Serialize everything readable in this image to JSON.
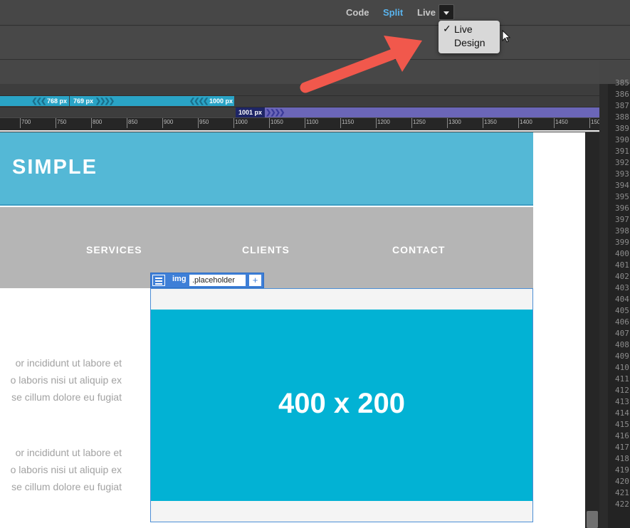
{
  "toolbar": {
    "code": "Code",
    "split": "Split",
    "live": "Live"
  },
  "view_menu": {
    "check": "✓",
    "items": [
      "Live",
      "Design"
    ]
  },
  "media_queries": {
    "mq1": "768",
    "mq2_left": "769",
    "mq2_right": "1000",
    "mq3": "1001",
    "unit": "px"
  },
  "ruler_ticks": [
    "700",
    "750",
    "800",
    "850",
    "900",
    "950",
    "1000",
    "1050",
    "1100",
    "1150",
    "1200",
    "1250",
    "1300",
    "1350",
    "1400",
    "1450",
    "150"
  ],
  "line_numbers": [
    "385",
    "386",
    "387",
    "388",
    "389",
    "390",
    "391",
    "392",
    "393",
    "394",
    "395",
    "396",
    "397",
    "398",
    "399",
    "400",
    "401",
    "402",
    "403",
    "404",
    "405",
    "406",
    "407",
    "408",
    "409",
    "410",
    "411",
    "412",
    "413",
    "414",
    "415",
    "416",
    "417",
    "418",
    "419",
    "420",
    "421",
    "422"
  ],
  "page": {
    "logo": "SIMPLE",
    "nav": [
      "SERVICES",
      "CLIENTS",
      "CONTACT"
    ],
    "para1": [
      "or incididunt ut labore et",
      "o laboris nisi ut aliquip ex",
      "se cillum dolore eu fugiat"
    ],
    "para2": [
      "or incididunt ut labore et",
      "o laboris nisi ut aliquip ex",
      "se cillum dolore eu fugiat"
    ],
    "image_text": "400 x 200"
  },
  "hud": {
    "tag": "img",
    "class": ".placeholder",
    "add": "+"
  },
  "colors": {
    "split_active": "#5ab4ee",
    "header": "#54b8d6",
    "nav": "#b5b5b5",
    "image": "#02b2d4",
    "arrow": "#f1584c",
    "mq_blue": "#2aa4c6",
    "mq_purple": "#6b66b8"
  }
}
